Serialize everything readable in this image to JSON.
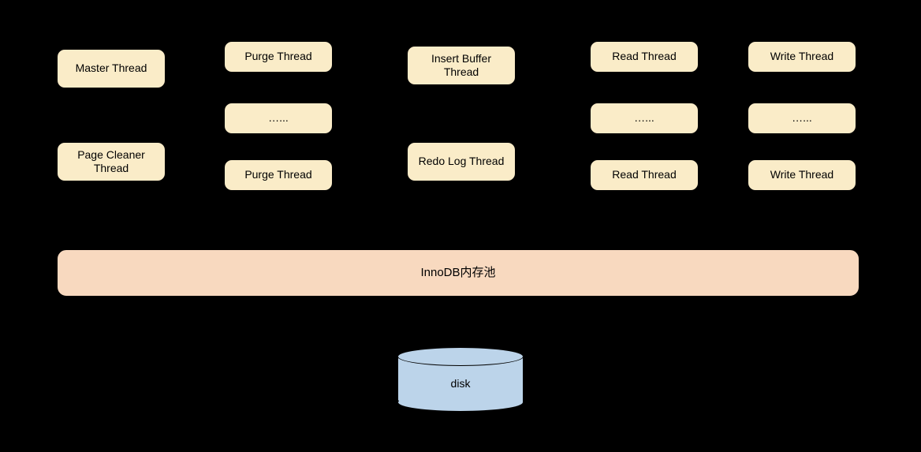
{
  "threads": {
    "master": "Master Thread",
    "page_cleaner": "Page Cleaner Thread",
    "purge_top": "Purge Thread",
    "purge_mid": "…...",
    "purge_bot": "Purge Thread",
    "insert_buffer": "Insert Buffer Thread",
    "redo_log": "Redo Log Thread",
    "read_top": "Read Thread",
    "read_mid": "…...",
    "read_bot": "Read Thread",
    "write_top": "Write Thread",
    "write_mid": "…...",
    "write_bot": "Write Thread"
  },
  "pool": {
    "label": "InnoDB内存池"
  },
  "disk": {
    "label": "disk"
  },
  "chart_data": {
    "type": "diagram",
    "title": "InnoDB thread architecture",
    "nodes": [
      {
        "id": "master",
        "label": "Master Thread",
        "group": "left"
      },
      {
        "id": "page_cleaner",
        "label": "Page Cleaner Thread",
        "group": "left"
      },
      {
        "id": "purge1",
        "label": "Purge Thread",
        "group": "purge"
      },
      {
        "id": "purge_more",
        "label": "…...",
        "group": "purge"
      },
      {
        "id": "purge2",
        "label": "Purge Thread",
        "group": "purge"
      },
      {
        "id": "insert_buffer",
        "label": "Insert Buffer Thread",
        "group": "center"
      },
      {
        "id": "redo_log",
        "label": "Redo Log Thread",
        "group": "center"
      },
      {
        "id": "read1",
        "label": "Read Thread",
        "group": "read"
      },
      {
        "id": "read_more",
        "label": "…...",
        "group": "read"
      },
      {
        "id": "read2",
        "label": "Read Thread",
        "group": "read"
      },
      {
        "id": "write1",
        "label": "Write Thread",
        "group": "write"
      },
      {
        "id": "write_more",
        "label": "…...",
        "group": "write"
      },
      {
        "id": "write2",
        "label": "Write Thread",
        "group": "write"
      },
      {
        "id": "pool",
        "label": "InnoDB内存池",
        "group": "memory"
      },
      {
        "id": "disk",
        "label": "disk",
        "group": "storage"
      }
    ],
    "edges": [
      {
        "from": "pool",
        "to": "disk",
        "bidirectional": true
      }
    ]
  }
}
